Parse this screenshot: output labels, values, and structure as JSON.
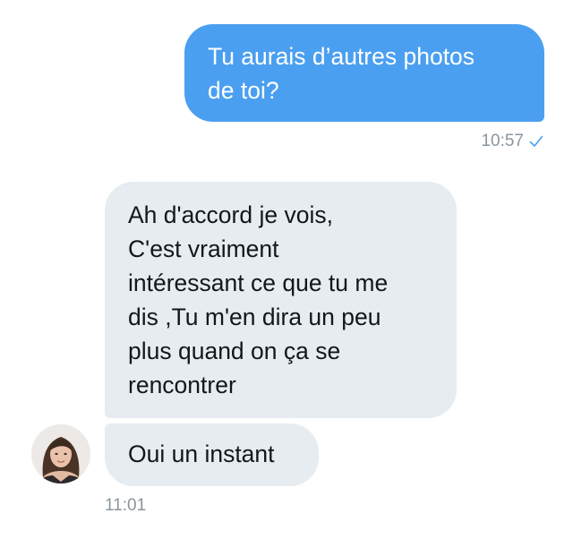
{
  "conversation": {
    "sent_message": {
      "text": "Tu aurais d’autres photos\nde toi?",
      "time": "10:57",
      "status_icon": "checkmark-icon"
    },
    "received_messages": [
      {
        "text": "Ah d'accord  je vois,\nC'est  vraiment\nintéressant ce que tu me\ndis ,Tu m'en dira un peu\nplus quand on ça se\nrencontrer"
      },
      {
        "text": "Oui un instant"
      }
    ],
    "received_time": "11:01",
    "avatar_icon": "user-avatar-photo"
  },
  "colors": {
    "sent_bubble": "#4a9ff0",
    "received_bubble": "#e6ecf0",
    "timestamp": "#8a959e",
    "check": "#4a9ff0"
  }
}
